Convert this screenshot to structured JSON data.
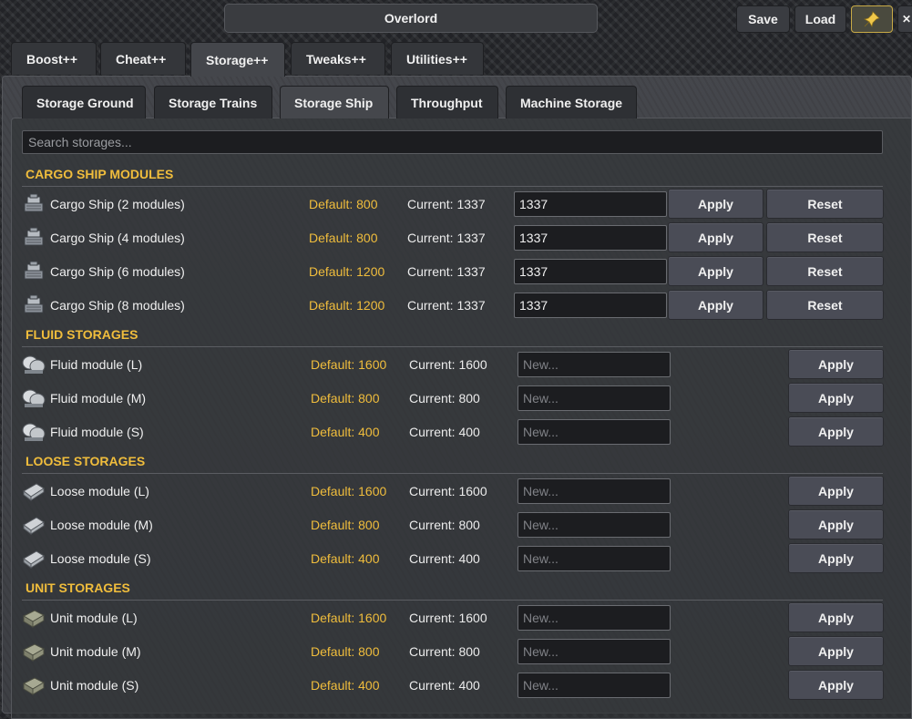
{
  "window": {
    "title": "Overlord"
  },
  "toolbar": {
    "save_label": "Save",
    "load_label": "Load",
    "pin_icon": "pin-icon"
  },
  "main_tabs": [
    {
      "label": "Boost++"
    },
    {
      "label": "Cheat++"
    },
    {
      "label": "Storage++",
      "active": true
    },
    {
      "label": "Tweaks++"
    },
    {
      "label": "Utilities++"
    }
  ],
  "sub_tabs": [
    {
      "label": "Storage Ground"
    },
    {
      "label": "Storage Trains"
    },
    {
      "label": "Storage Ship",
      "active": true
    },
    {
      "label": "Throughput"
    },
    {
      "label": "Machine Storage"
    }
  ],
  "search": {
    "placeholder": "Search storages..."
  },
  "colors": {
    "accent": "#f0bd3c",
    "button": "#4a4c56",
    "input_bg": "#1c1d20"
  },
  "sections": [
    {
      "title": "CARGO SHIP MODULES",
      "rows": [
        {
          "icon": "ship-module-icon",
          "name": "Cargo Ship (2 modules)",
          "default": "Default: 800",
          "current": "Current: 1337",
          "value": "1337",
          "placeholder": "",
          "apply": "Apply",
          "reset": "Reset"
        },
        {
          "icon": "ship-module-icon",
          "name": "Cargo Ship (4 modules)",
          "default": "Default: 800",
          "current": "Current: 1337",
          "value": "1337",
          "placeholder": "",
          "apply": "Apply",
          "reset": "Reset"
        },
        {
          "icon": "ship-module-icon",
          "name": "Cargo Ship (6 modules)",
          "default": "Default: 1200",
          "current": "Current: 1337",
          "value": "1337",
          "placeholder": "",
          "apply": "Apply",
          "reset": "Reset"
        },
        {
          "icon": "ship-module-icon",
          "name": "Cargo Ship (8 modules)",
          "default": "Default: 1200",
          "current": "Current: 1337",
          "value": "1337",
          "placeholder": "",
          "apply": "Apply",
          "reset": "Reset"
        }
      ]
    },
    {
      "title": "FLUID STORAGES",
      "rows": [
        {
          "icon": "fluid-tank-icon",
          "name": "Fluid module (L)",
          "default": "Default: 1600",
          "current": "Current: 1600",
          "value": "",
          "placeholder": "New...",
          "apply": "Apply"
        },
        {
          "icon": "fluid-tank-icon",
          "name": "Fluid module (M)",
          "default": "Default: 800",
          "current": "Current: 800",
          "value": "",
          "placeholder": "New...",
          "apply": "Apply"
        },
        {
          "icon": "fluid-tank-icon",
          "name": "Fluid module (S)",
          "default": "Default: 400",
          "current": "Current: 400",
          "value": "",
          "placeholder": "New...",
          "apply": "Apply"
        }
      ]
    },
    {
      "title": "LOOSE STORAGES",
      "rows": [
        {
          "icon": "loose-container-icon",
          "name": "Loose module (L)",
          "default": "Default: 1600",
          "current": "Current: 1600",
          "value": "",
          "placeholder": "New...",
          "apply": "Apply"
        },
        {
          "icon": "loose-container-icon",
          "name": "Loose module (M)",
          "default": "Default: 800",
          "current": "Current: 800",
          "value": "",
          "placeholder": "New...",
          "apply": "Apply"
        },
        {
          "icon": "loose-container-icon",
          "name": "Loose module (S)",
          "default": "Default: 400",
          "current": "Current: 400",
          "value": "",
          "placeholder": "New...",
          "apply": "Apply"
        }
      ]
    },
    {
      "title": "UNIT STORAGES",
      "rows": [
        {
          "icon": "unit-crate-icon",
          "name": "Unit module (L)",
          "default": "Default: 1600",
          "current": "Current: 1600",
          "value": "",
          "placeholder": "New...",
          "apply": "Apply"
        },
        {
          "icon": "unit-crate-icon",
          "name": "Unit module (M)",
          "default": "Default: 800",
          "current": "Current: 800",
          "value": "",
          "placeholder": "New...",
          "apply": "Apply"
        },
        {
          "icon": "unit-crate-icon",
          "name": "Unit module (S)",
          "default": "Default: 400",
          "current": "Current: 400",
          "value": "",
          "placeholder": "New...",
          "apply": "Apply"
        }
      ]
    }
  ]
}
